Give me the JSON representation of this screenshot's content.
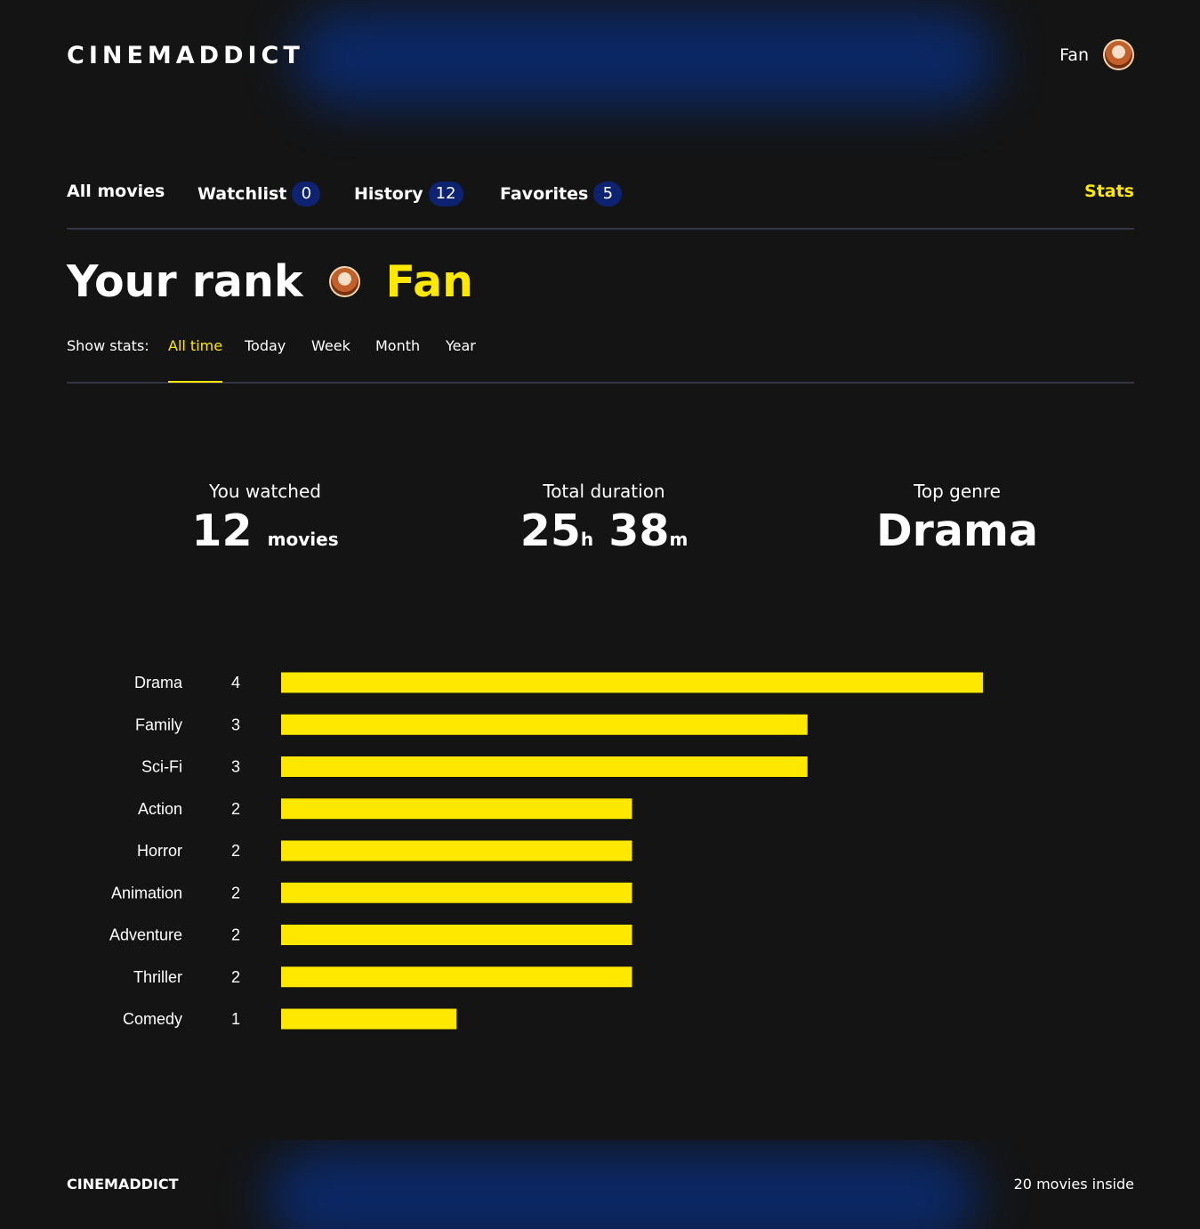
{
  "header": {
    "logo": "CINEMADDICT",
    "profile_rating": "Fan"
  },
  "nav": {
    "all_movies": "All movies",
    "watchlist": {
      "label": "Watchlist",
      "count": "0"
    },
    "history": {
      "label": "History",
      "count": "12"
    },
    "favorites": {
      "label": "Favorites",
      "count": "5"
    },
    "stats": "Stats"
  },
  "rank": {
    "title": "Your rank",
    "label": "Fan"
  },
  "filter": {
    "label": "Show stats:",
    "options": [
      "All time",
      "Today",
      "Week",
      "Month",
      "Year"
    ],
    "active": "All time"
  },
  "stats": {
    "watched": {
      "title": "You watched",
      "value": "12",
      "unit": "movies"
    },
    "duration": {
      "title": "Total duration",
      "hours": "25",
      "hours_unit": "h",
      "minutes": "38",
      "minutes_unit": "m"
    },
    "genre": {
      "title": "Top genre",
      "value": "Drama"
    }
  },
  "colors": {
    "accent": "#ffe800",
    "badge": "#0d2372",
    "background": "#141414",
    "glow": "#0a2a6e"
  },
  "chart_data": {
    "type": "bar",
    "orientation": "horizontal",
    "categories": [
      "Drama",
      "Family",
      "Sci-Fi",
      "Action",
      "Horror",
      "Animation",
      "Adventure",
      "Thriller",
      "Comedy"
    ],
    "values": [
      4,
      3,
      3,
      2,
      2,
      2,
      2,
      2,
      1
    ],
    "xlim": [
      0,
      4
    ],
    "color": "#ffe800",
    "grid": false
  },
  "footer": {
    "logo": "CINEMADDICT",
    "statistics": "20 movies inside"
  }
}
